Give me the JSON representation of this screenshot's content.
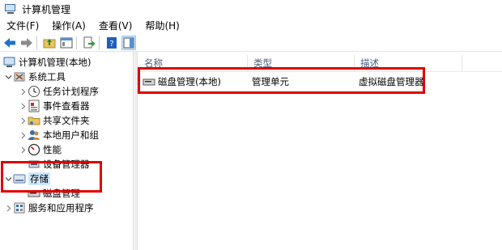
{
  "window": {
    "title": "计算机管理"
  },
  "menu": {
    "items": [
      "文件(F)",
      "操作(A)",
      "查看(V)",
      "帮助(H)"
    ]
  },
  "toolbar": {
    "buttons": [
      "back-arrow-icon",
      "forward-arrow-icon",
      "up-folder-icon",
      "show-hide-console-tree-icon",
      "export-list-icon",
      "help-icon",
      "action-pane-icon"
    ]
  },
  "tree": {
    "root": "计算机管理(本地)",
    "system_tools": "系统工具",
    "task_scheduler": "任务计划程序",
    "event_viewer": "事件查看器",
    "shared_folders": "共享文件夹",
    "local_users": "本地用户和组",
    "performance": "性能",
    "device_manager": "设备管理器",
    "storage": "存储",
    "disk_management": "磁盘管理",
    "services_apps": "服务和应用程序"
  },
  "list": {
    "columns": [
      "名称",
      "类型",
      "描述"
    ],
    "rows": [
      {
        "name": "磁盘管理(本地)",
        "type": "管理单元",
        "description": "虚拟磁盘管理器"
      }
    ]
  },
  "colors": {
    "highlight_box": "#e10000",
    "selection": "#cce8ff",
    "header_text": "#4c607a"
  }
}
